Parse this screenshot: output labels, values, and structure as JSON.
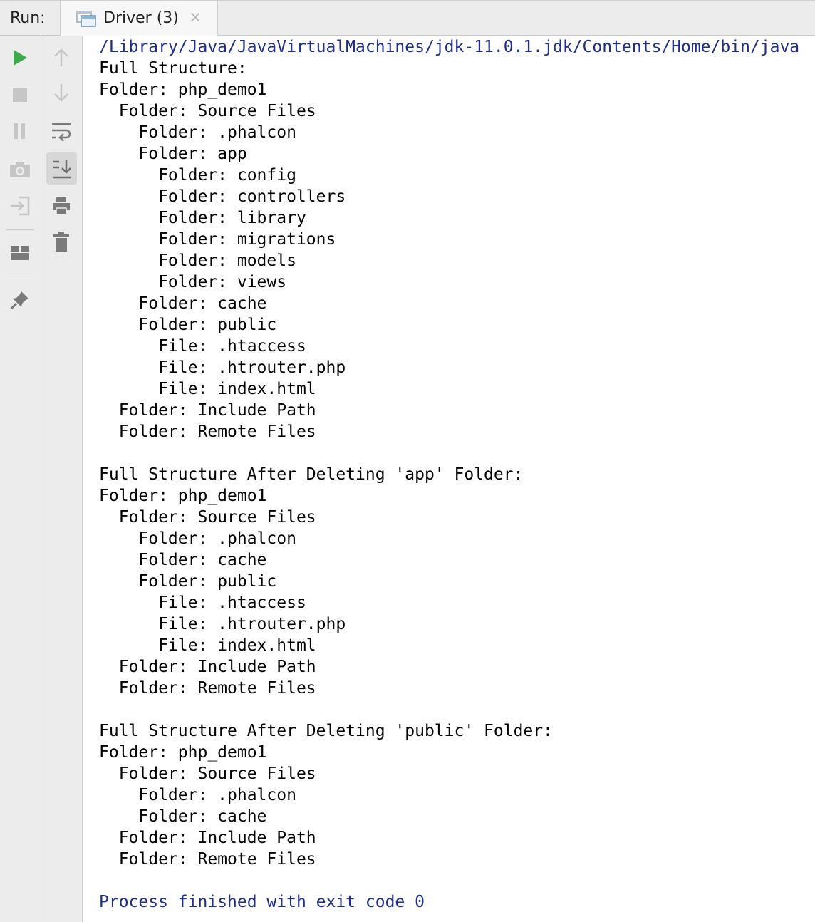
{
  "run_panel": {
    "label": "Run:",
    "tab": {
      "label": "Driver (3)",
      "icon": "window-icon",
      "close_glyph": "×"
    }
  },
  "toolbar_left": [
    {
      "name": "run-icon",
      "color": "#3aaa4a"
    },
    {
      "name": "stop-icon"
    },
    {
      "name": "pause-icon"
    },
    {
      "name": "camera-icon"
    },
    {
      "name": "login-icon"
    },
    {
      "name": "layout-icon"
    },
    {
      "name": "pin-icon"
    }
  ],
  "toolbar_right": [
    {
      "name": "arrow-up-icon"
    },
    {
      "name": "arrow-down-icon"
    },
    {
      "name": "soft-wrap-icon"
    },
    {
      "name": "scroll-to-end-icon",
      "active": true
    },
    {
      "name": "print-icon"
    },
    {
      "name": "trash-icon"
    }
  ],
  "colors": {
    "system_text": "#1f2e8c",
    "output_text": "#000000",
    "run_green": "#3aaa4a",
    "active_button_bg": "#d7d7d7"
  },
  "console": {
    "lines": [
      {
        "text": "/Library/Java/JavaVirtualMachines/jdk-11.0.1.jdk/Contents/Home/bin/java",
        "kind": "system"
      },
      {
        "text": "Full Structure:",
        "kind": "output"
      },
      {
        "text": "Folder: php_demo1",
        "kind": "output"
      },
      {
        "text": "  Folder: Source Files",
        "kind": "output"
      },
      {
        "text": "    Folder: .phalcon",
        "kind": "output"
      },
      {
        "text": "    Folder: app",
        "kind": "output"
      },
      {
        "text": "      Folder: config",
        "kind": "output"
      },
      {
        "text": "      Folder: controllers",
        "kind": "output"
      },
      {
        "text": "      Folder: library",
        "kind": "output"
      },
      {
        "text": "      Folder: migrations",
        "kind": "output"
      },
      {
        "text": "      Folder: models",
        "kind": "output"
      },
      {
        "text": "      Folder: views",
        "kind": "output"
      },
      {
        "text": "    Folder: cache",
        "kind": "output"
      },
      {
        "text": "    Folder: public",
        "kind": "output"
      },
      {
        "text": "      File: .htaccess",
        "kind": "output"
      },
      {
        "text": "      File: .htrouter.php",
        "kind": "output"
      },
      {
        "text": "      File: index.html",
        "kind": "output"
      },
      {
        "text": "  Folder: Include Path",
        "kind": "output"
      },
      {
        "text": "  Folder: Remote Files",
        "kind": "output"
      },
      {
        "text": "",
        "kind": "output"
      },
      {
        "text": "Full Structure After Deleting 'app' Folder:",
        "kind": "output"
      },
      {
        "text": "Folder: php_demo1",
        "kind": "output"
      },
      {
        "text": "  Folder: Source Files",
        "kind": "output"
      },
      {
        "text": "    Folder: .phalcon",
        "kind": "output"
      },
      {
        "text": "    Folder: cache",
        "kind": "output"
      },
      {
        "text": "    Folder: public",
        "kind": "output"
      },
      {
        "text": "      File: .htaccess",
        "kind": "output"
      },
      {
        "text": "      File: .htrouter.php",
        "kind": "output"
      },
      {
        "text": "      File: index.html",
        "kind": "output"
      },
      {
        "text": "  Folder: Include Path",
        "kind": "output"
      },
      {
        "text": "  Folder: Remote Files",
        "kind": "output"
      },
      {
        "text": "",
        "kind": "output"
      },
      {
        "text": "Full Structure After Deleting 'public' Folder:",
        "kind": "output"
      },
      {
        "text": "Folder: php_demo1",
        "kind": "output"
      },
      {
        "text": "  Folder: Source Files",
        "kind": "output"
      },
      {
        "text": "    Folder: .phalcon",
        "kind": "output"
      },
      {
        "text": "    Folder: cache",
        "kind": "output"
      },
      {
        "text": "  Folder: Include Path",
        "kind": "output"
      },
      {
        "text": "  Folder: Remote Files",
        "kind": "output"
      },
      {
        "text": "",
        "kind": "output"
      },
      {
        "text": "Process finished with exit code 0",
        "kind": "system"
      }
    ]
  }
}
